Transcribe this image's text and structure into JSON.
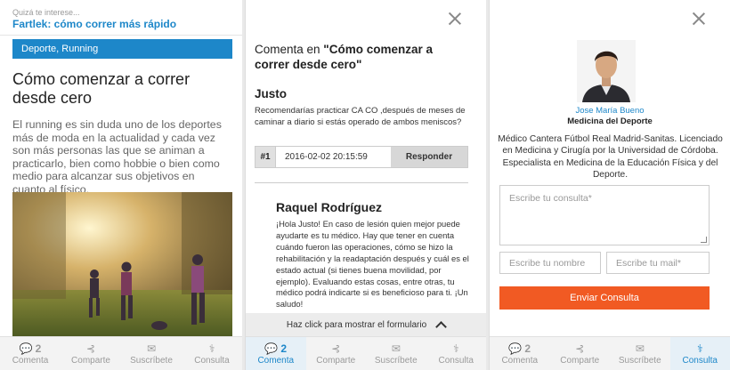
{
  "colors": {
    "accent": "#1d87c9",
    "cta": "#f15a23"
  },
  "panel1": {
    "eyebrow": "Quizá te interese...",
    "link": "Fartlek: cómo correr más rápido",
    "category": "Deporte, Running",
    "title": "Cómo comenzar a correr desde cero",
    "body": "El running es sin duda uno de los deportes más de moda en la actualidad y cada vez son más personas las que se animan a practicarlo, bien como hobbie o bien como medio para alcanzar sus objetivos en cuanto al físico."
  },
  "panel2": {
    "heading_prefix": "Comenta en ",
    "heading_article": "\"Cómo comenzar a correr desde cero\"",
    "comment1": {
      "author": "Justo",
      "text": "Recomendarías practicar CA CO ,después de meses de caminar a diario si estás operado de ambos meniscos?",
      "number": "#1",
      "date": "2016-02-02 20:15:59",
      "reply_label": "Responder"
    },
    "comment2": {
      "author": "Raquel Rodríguez",
      "text": "¡Hola Justo! En caso de lesión quien mejor puede ayudarte es tu médico. Hay que tener en cuenta cuándo fueron las operaciones, cómo se hizo la rehabilitación y la readaptación después y cuál es el estado actual (si tienes buena movilidad, por ejemplo). Evaluando estas cosas, entre otras, tu médico podrá indicarte si es beneficioso para ti. ¡Un saludo!"
    },
    "show_form_label": "Haz click para mostrar el formulario"
  },
  "panel3": {
    "doctor_name": "Jose María Bueno",
    "doctor_role": "Medicina del Deporte",
    "bio": "Médico Cantera Fútbol Real Madrid-Sanitas. Licenciado en Medicina y Cirugía por la Universidad de Córdoba. Especialista en Medicina de la Educación Física y del Deporte.",
    "query_placeholder": "Escribe tu consulta*",
    "name_placeholder": "Escribe tu nombre",
    "mail_placeholder": "Escribe tu mail*",
    "submit_label": "Enviar Consulta"
  },
  "bottombar": {
    "comment_count": "2",
    "comenta": "Comenta",
    "comparte": "Comparte",
    "suscribete": "Suscríbete",
    "consulta": "Consulta"
  },
  "icons": [
    "comment-icon",
    "share-icon",
    "mail-icon",
    "stethoscope-icon",
    "close-icon",
    "chevron-up-icon"
  ]
}
